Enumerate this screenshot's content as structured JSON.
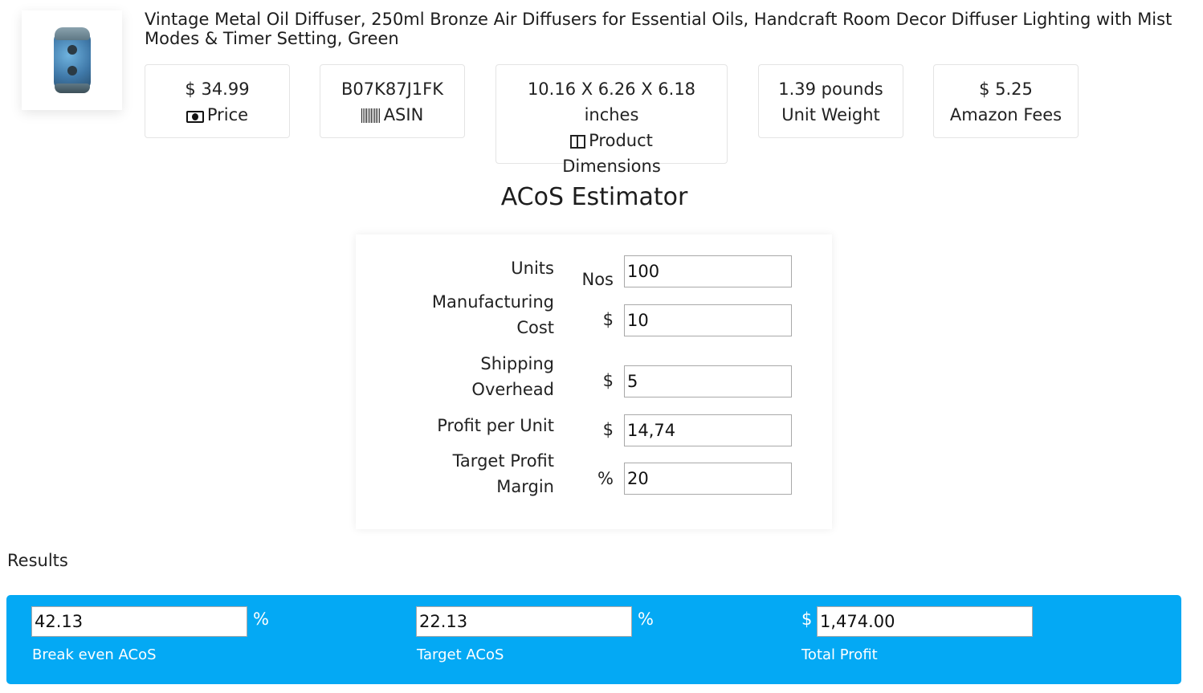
{
  "product": {
    "image_alt": "diffuser-product-image",
    "title": "Vintage Metal Oil Diffuser, 250ml Bronze Air Diffusers for Essential Oils, Handcraft Room Decor Diffuser Lighting with Mist Modes & Timer Setting, Green"
  },
  "stats": [
    {
      "value": "$ 34.99",
      "label": "Price",
      "icon": "money-icon"
    },
    {
      "value": "B07K87J1FK",
      "label": "ASIN",
      "icon": "barcode-icon"
    },
    {
      "value": "10.16 X 6.26 X 6.18 inches",
      "label": "Product Dimensions",
      "icon": "columns-icon"
    },
    {
      "value": "1.39 pounds",
      "label": "Unit Weight"
    },
    {
      "value": "$ 5.25",
      "label": "Amazon Fees"
    }
  ],
  "estimator": {
    "title": "ACoS Estimator",
    "fields": [
      {
        "label": "Units",
        "unit": "Nos",
        "value": "100"
      },
      {
        "label_line1": "Manufacturing",
        "label_line2": "Cost",
        "unit": "$",
        "value": "10"
      },
      {
        "label_line1": "Shipping",
        "label_line2": "Overhead",
        "unit": "$",
        "value": "5"
      },
      {
        "label": "Profit per Unit",
        "unit": "$",
        "value": "14,74"
      },
      {
        "label_line1": "Target Profit",
        "label_line2": "Margin",
        "unit": "%",
        "value": "20"
      }
    ]
  },
  "results": {
    "heading": "Results",
    "accent_color": "#04a9f4",
    "items": [
      {
        "value": "42.13",
        "suffix": "%",
        "caption": "Break even ACoS"
      },
      {
        "value": "22.13",
        "suffix": "%",
        "caption": "Target ACoS"
      },
      {
        "value": "1,474.00",
        "prefix": "$",
        "caption": "Total Profit"
      }
    ]
  }
}
